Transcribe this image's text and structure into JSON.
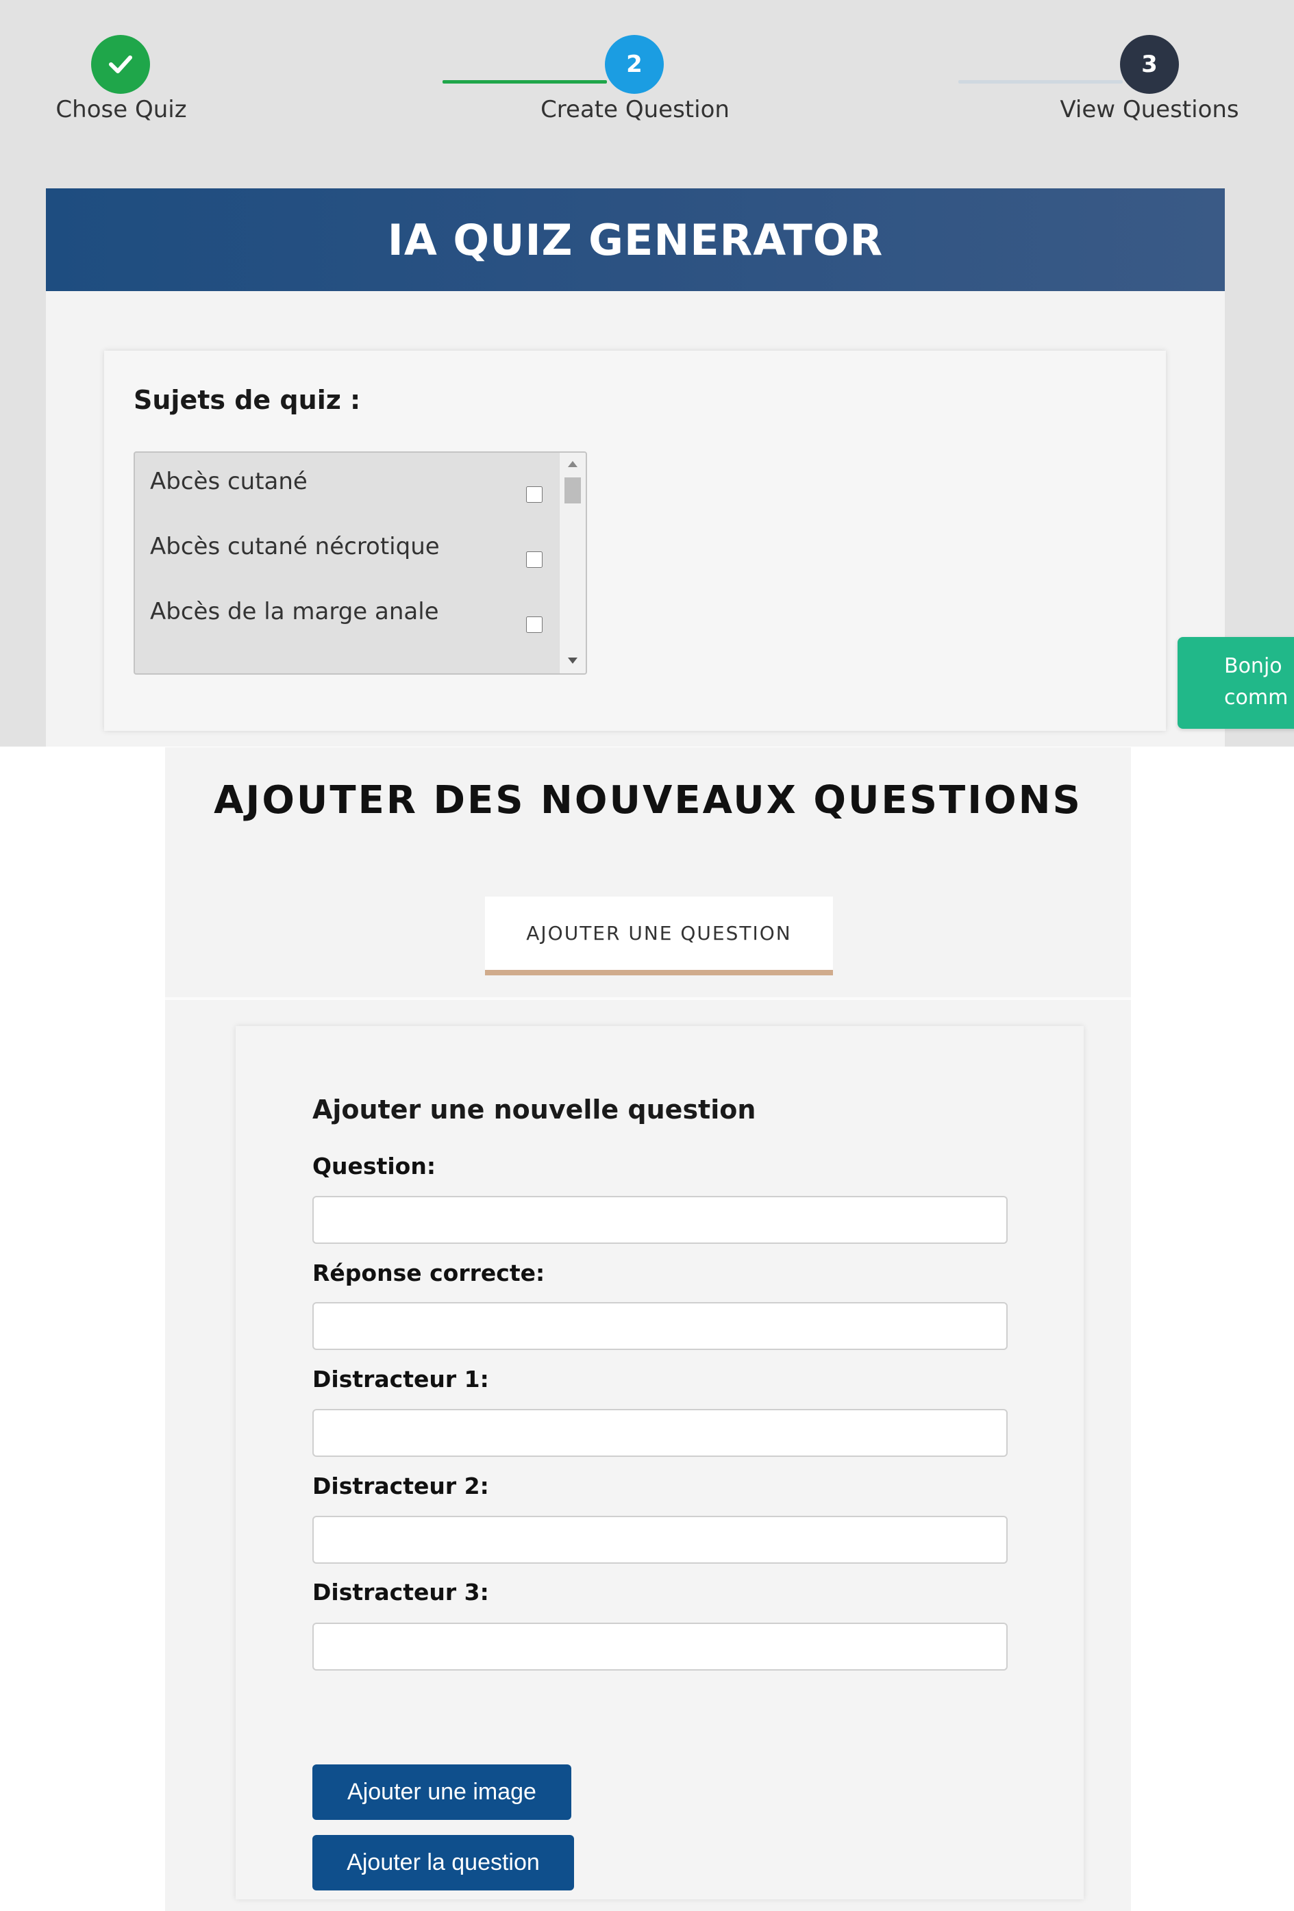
{
  "stepper": {
    "steps": [
      {
        "label": "Chose Quiz",
        "number": "",
        "status": "completed",
        "color": "#1fa64a"
      },
      {
        "label": "Create Question",
        "number": "2",
        "status": "active",
        "color": "#1b9de2"
      },
      {
        "label": "View Questions",
        "number": "3",
        "status": "pending",
        "color": "#2b3445"
      }
    ],
    "completed_line_color": "#1fa64a",
    "pending_line_color": "#cfd8e0"
  },
  "quiz_generator": {
    "title": "IA QUIZ GENERATOR",
    "subjects_label": "Sujets de quiz :",
    "subjects": [
      {
        "name": "Abcès cutané",
        "checked": false
      },
      {
        "name": "Abcès cutané nécrotique",
        "checked": false
      },
      {
        "name": "Abcès de la marge anale",
        "checked": false
      }
    ]
  },
  "chat_widget": {
    "text": "Bonjo\ncomm"
  },
  "add_questions": {
    "title": "AJOUTER DES NOUVEAUX QUESTIONS",
    "tab_label": "AJOUTER UNE QUESTION",
    "form_title": "Ajouter une nouvelle question",
    "fields": {
      "question": {
        "label": "Question:",
        "value": ""
      },
      "correct_answer": {
        "label": "Réponse correcte:",
        "value": ""
      },
      "distractor1": {
        "label": "Distracteur 1:",
        "value": ""
      },
      "distractor2": {
        "label": "Distracteur 2:",
        "value": ""
      },
      "distractor3": {
        "label": "Distracteur 3:",
        "value": ""
      }
    },
    "add_image_label": "Ajouter une image",
    "add_question_label": "Ajouter la question"
  },
  "colors": {
    "header_blue": "#2c5282",
    "button_blue": "#0f4f8c",
    "tab_underline": "#d0ab8c",
    "chat_green": "#21b889"
  }
}
